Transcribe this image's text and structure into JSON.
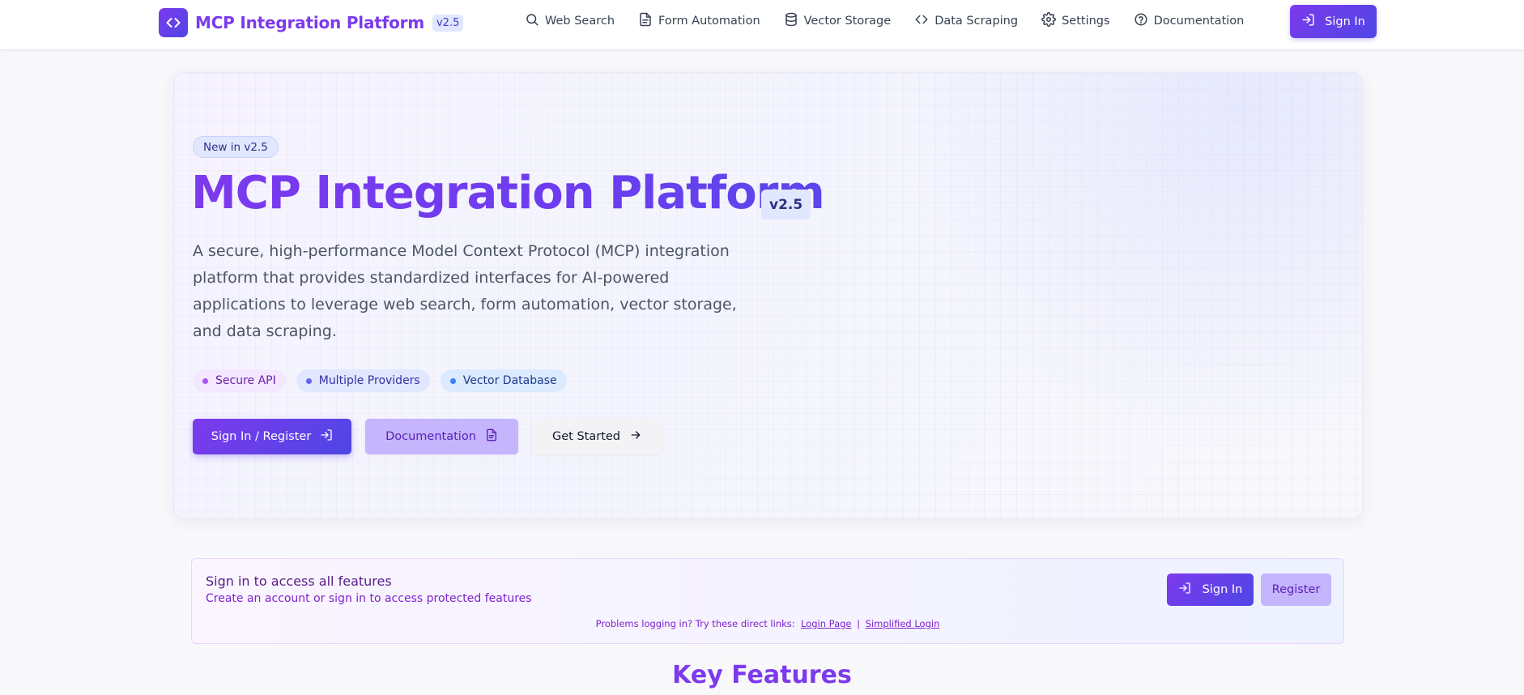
{
  "header": {
    "brand_title": "MCP Integration Platform",
    "version": "v2.5",
    "nav": [
      {
        "label": "Web Search",
        "icon": "search-icon"
      },
      {
        "label": "Form Automation",
        "icon": "file-text-icon"
      },
      {
        "label": "Vector Storage",
        "icon": "database-icon"
      },
      {
        "label": "Data Scraping",
        "icon": "code-icon"
      },
      {
        "label": "Settings",
        "icon": "gear-icon"
      },
      {
        "label": "Documentation",
        "icon": "help-circle-icon"
      }
    ],
    "signin_label": "Sign In"
  },
  "hero": {
    "badge": "New in v2.5",
    "title": "MCP Integration Platform",
    "version": "v2.5",
    "description": "A secure, high-performance Model Context Protocol (MCP) integration platform that provides standardized interfaces for AI-powered applications to leverage web search, form automation, vector storage, and data scraping.",
    "tags": [
      {
        "label": "Secure API",
        "color": "#a855f7"
      },
      {
        "label": "Multiple Providers",
        "color": "#6366f1"
      },
      {
        "label": "Vector Database",
        "color": "#3b82f6"
      }
    ],
    "buttons": {
      "primary": "Sign In / Register",
      "secondary": "Documentation",
      "ghost": "Get Started"
    }
  },
  "auth_banner": {
    "title": "Sign in to access all features",
    "subtitle": "Create an account or sign in to access protected features",
    "signin_label": "Sign In",
    "register_label": "Register",
    "help_text": "Problems logging in? Try these direct links:",
    "help_links": [
      "Login Page",
      "Simplified Login"
    ],
    "separator": "|"
  },
  "features": {
    "title": "Key Features"
  },
  "colors": {
    "accent": "#7c3aed",
    "accent_indigo": "#4f46e5",
    "accent_light": "#c4b5fd",
    "badge_bg": "#e0e7ff"
  }
}
